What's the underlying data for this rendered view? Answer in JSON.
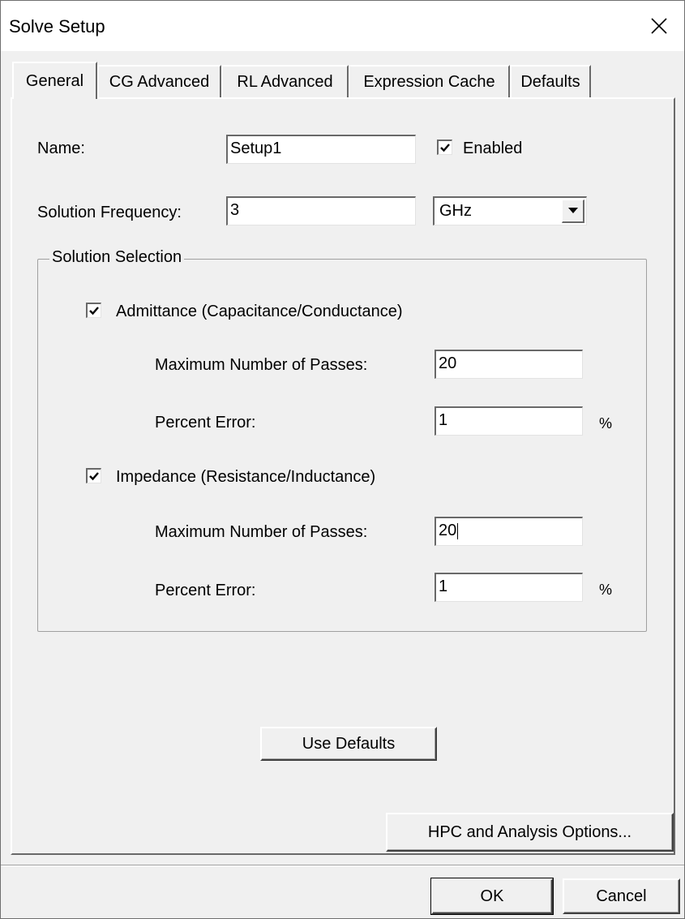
{
  "window": {
    "title": "Solve Setup"
  },
  "tabs": [
    {
      "label": "General",
      "active": true
    },
    {
      "label": "CG Advanced",
      "active": false
    },
    {
      "label": "RL Advanced",
      "active": false
    },
    {
      "label": "Expression Cache",
      "active": false
    },
    {
      "label": "Defaults",
      "active": false
    }
  ],
  "general": {
    "name_label": "Name:",
    "name_value": "Setup1",
    "enabled_label": "Enabled",
    "enabled_checked": true,
    "freq_label": "Solution Frequency:",
    "freq_value": "3",
    "freq_unit": "GHz"
  },
  "solution_selection": {
    "title": "Solution Selection",
    "admittance": {
      "label": "Admittance (Capacitance/Conductance)",
      "checked": true,
      "max_passes_label": "Maximum Number of Passes:",
      "max_passes_value": "20",
      "percent_error_label": "Percent Error:",
      "percent_error_value": "1",
      "percent_unit": "%"
    },
    "impedance": {
      "label": "Impedance (Resistance/Inductance)",
      "checked": true,
      "max_passes_label": "Maximum Number of Passes:",
      "max_passes_value": "20",
      "percent_error_label": "Percent Error:",
      "percent_error_value": "1",
      "percent_unit": "%"
    }
  },
  "buttons": {
    "use_defaults": "Use Defaults",
    "hpc_options": "HPC and Analysis Options...",
    "ok": "OK",
    "cancel": "Cancel"
  },
  "icons": {
    "close": "close-icon",
    "check": "check-icon",
    "dropdown": "chevron-down-icon"
  }
}
